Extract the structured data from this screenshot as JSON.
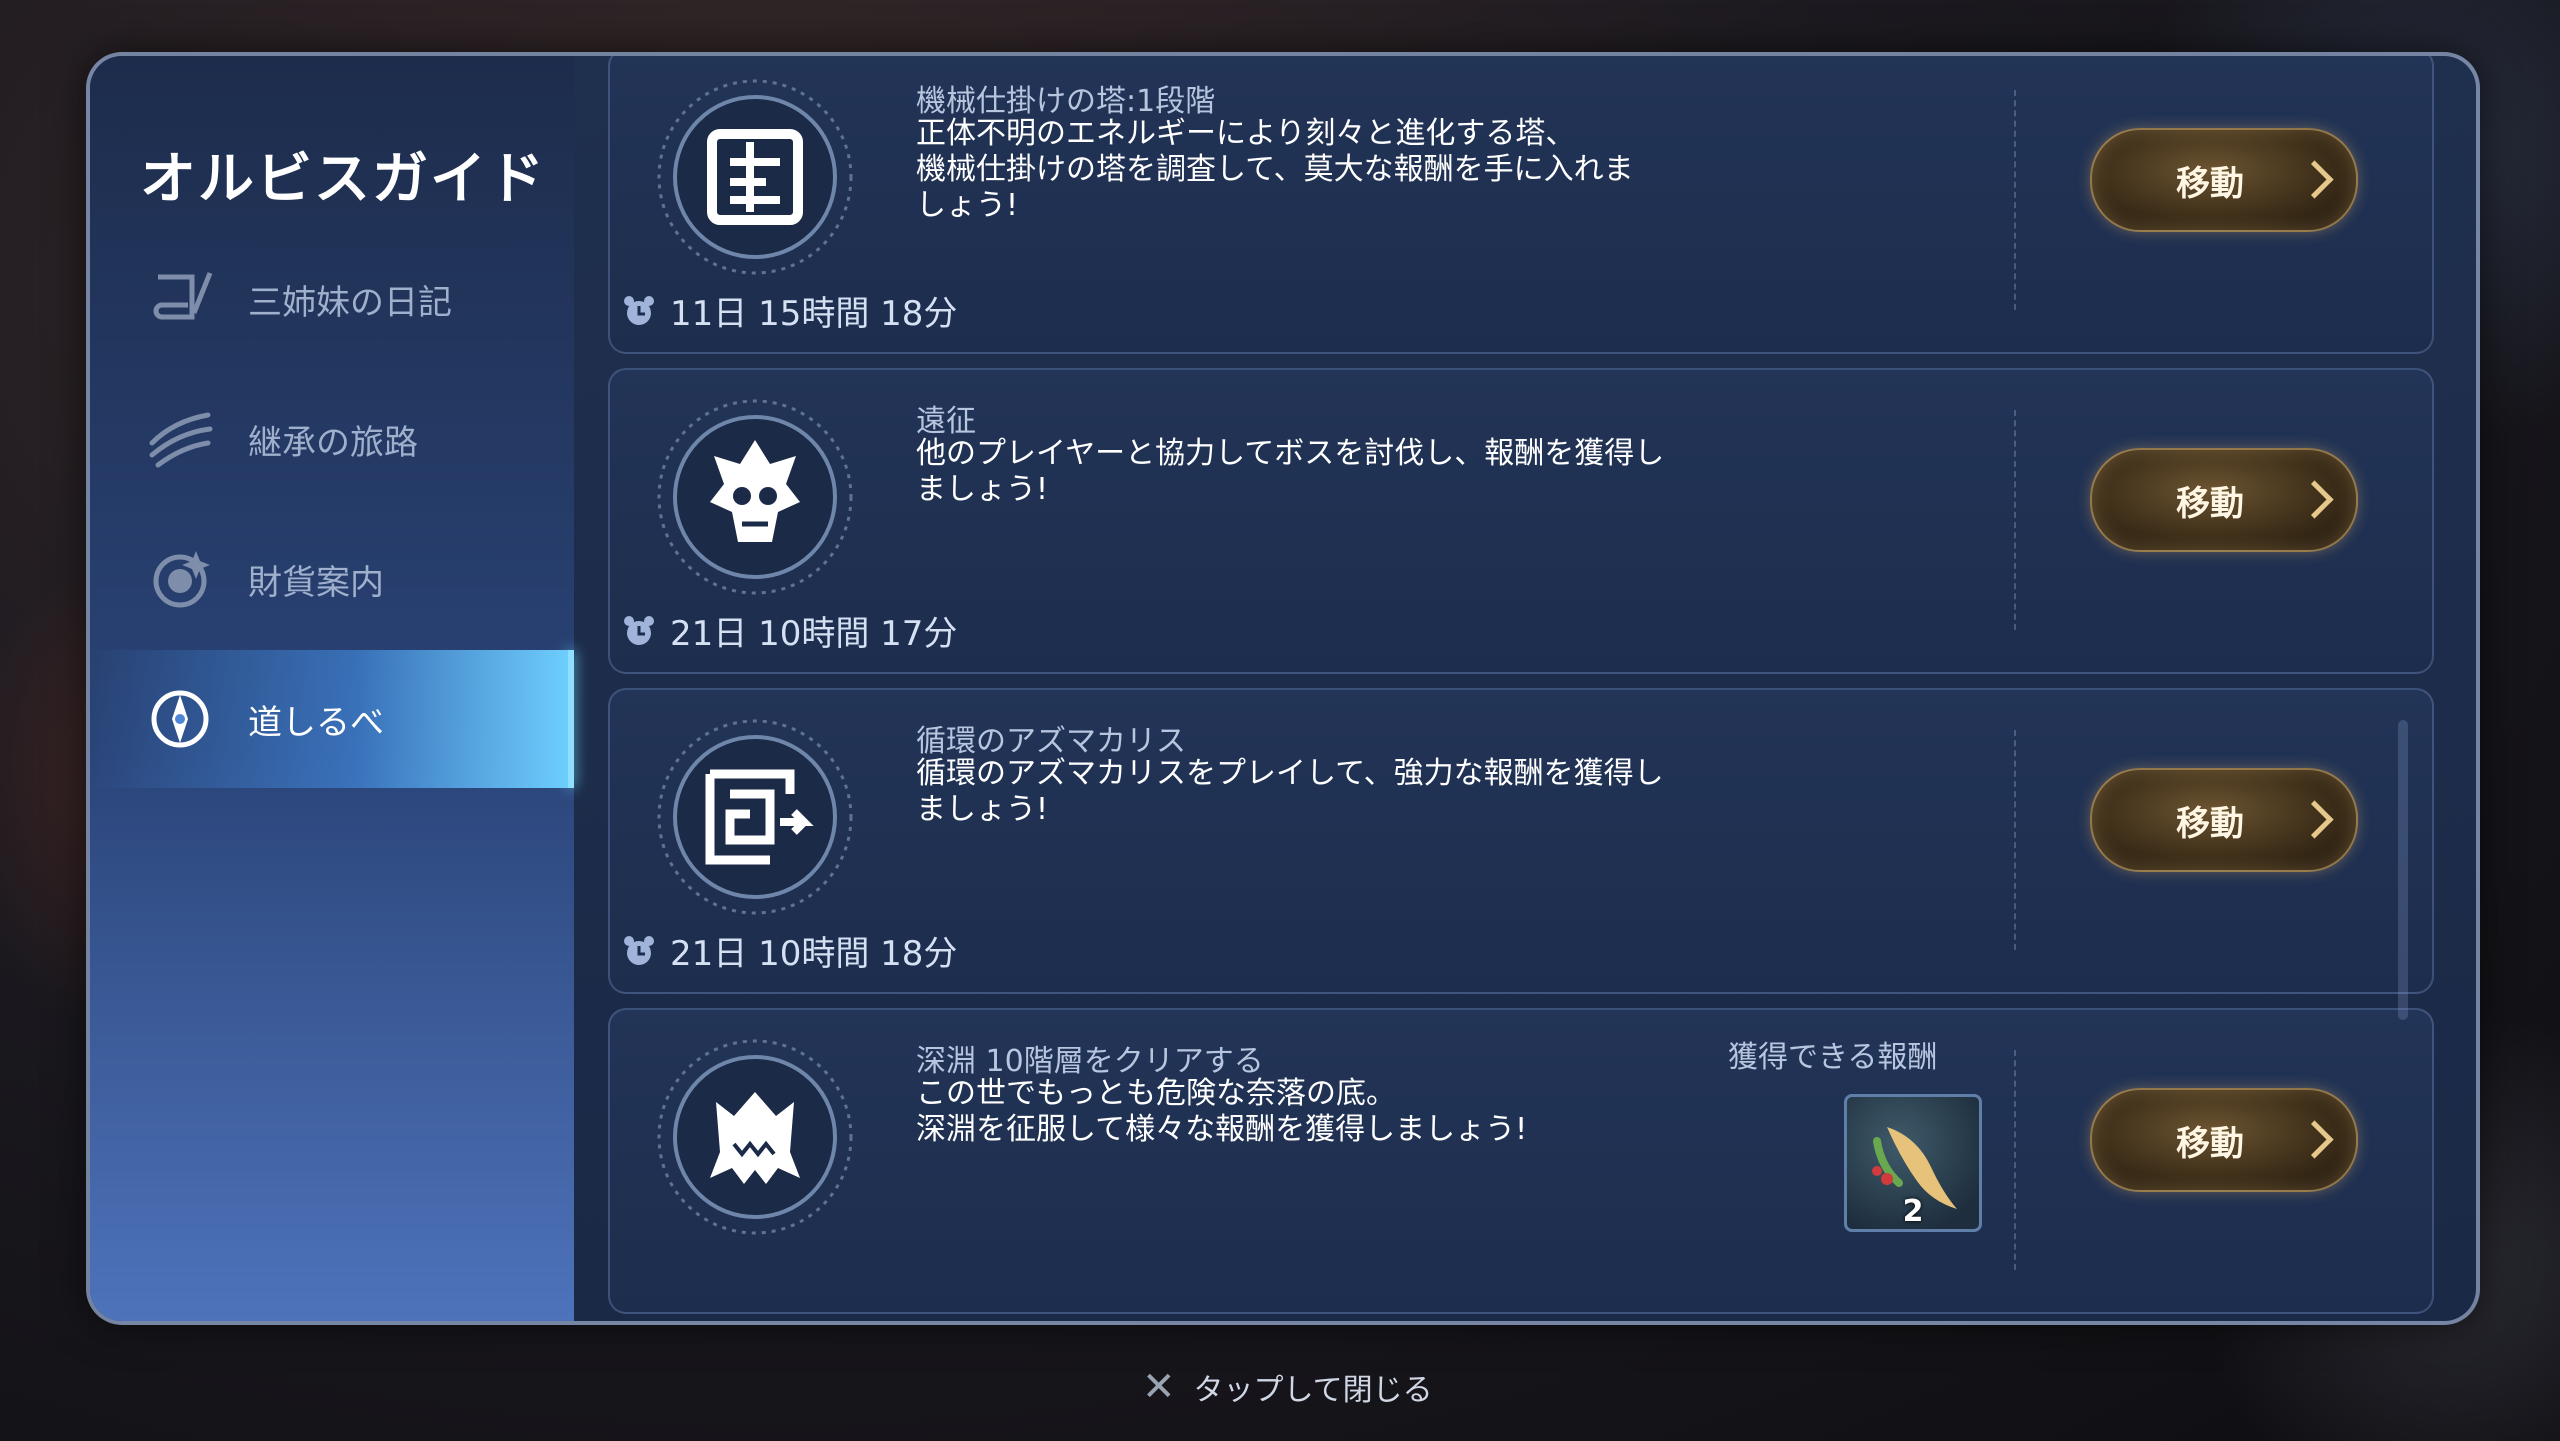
{
  "sidebar": {
    "title": "オルビスガイド",
    "items": [
      {
        "label": "三姉妹の日記",
        "icon": "scroll-quill-icon",
        "active": false
      },
      {
        "label": "継承の旅路",
        "icon": "claw-slash-icon",
        "active": false
      },
      {
        "label": "財貨案内",
        "icon": "coin-orb-icon",
        "active": false
      },
      {
        "label": "道しるべ",
        "icon": "compass-icon",
        "active": true
      }
    ]
  },
  "cards": [
    {
      "title": "機械仕掛けの塔:1段階",
      "description": "正体不明のエネルギーにより刻々と進化する塔、\n機械仕掛けの塔を調査して、莫大な報酬を手に入れま\nしょう!",
      "timer": "11日 15時間 18分",
      "emblem": "mechanical-tower-icon",
      "button": "移動"
    },
    {
      "title": "遠征",
      "description": "他のプレイヤーと協力してボスを討伐し、報酬を獲得し\nましょう!",
      "timer": "21日 10時間 17分",
      "emblem": "boss-skull-icon",
      "button": "移動"
    },
    {
      "title": "循環のアズマカリス",
      "description": "循環のアズマカリスをプレイして、強力な報酬を獲得し\nましょう!",
      "timer": "21日 10時間 18分",
      "emblem": "maze-icon",
      "button": "移動"
    },
    {
      "title": "深淵 10階層をクリアする",
      "description": "この世でもっとも危険な奈落の底。\n深淵を征服して様々な報酬を獲得しましょう!",
      "reward_label": "獲得できる報酬",
      "reward_count": "2",
      "reward_icon": "ginseng-root-icon",
      "emblem": "abyss-monster-icon",
      "button": "移動"
    }
  ],
  "footer": {
    "close_label": "タップして閉じる"
  },
  "colors": {
    "accent_active": "#6fd0ff",
    "button_gold": "#e7c88c",
    "panel": "#1f2f4e"
  }
}
